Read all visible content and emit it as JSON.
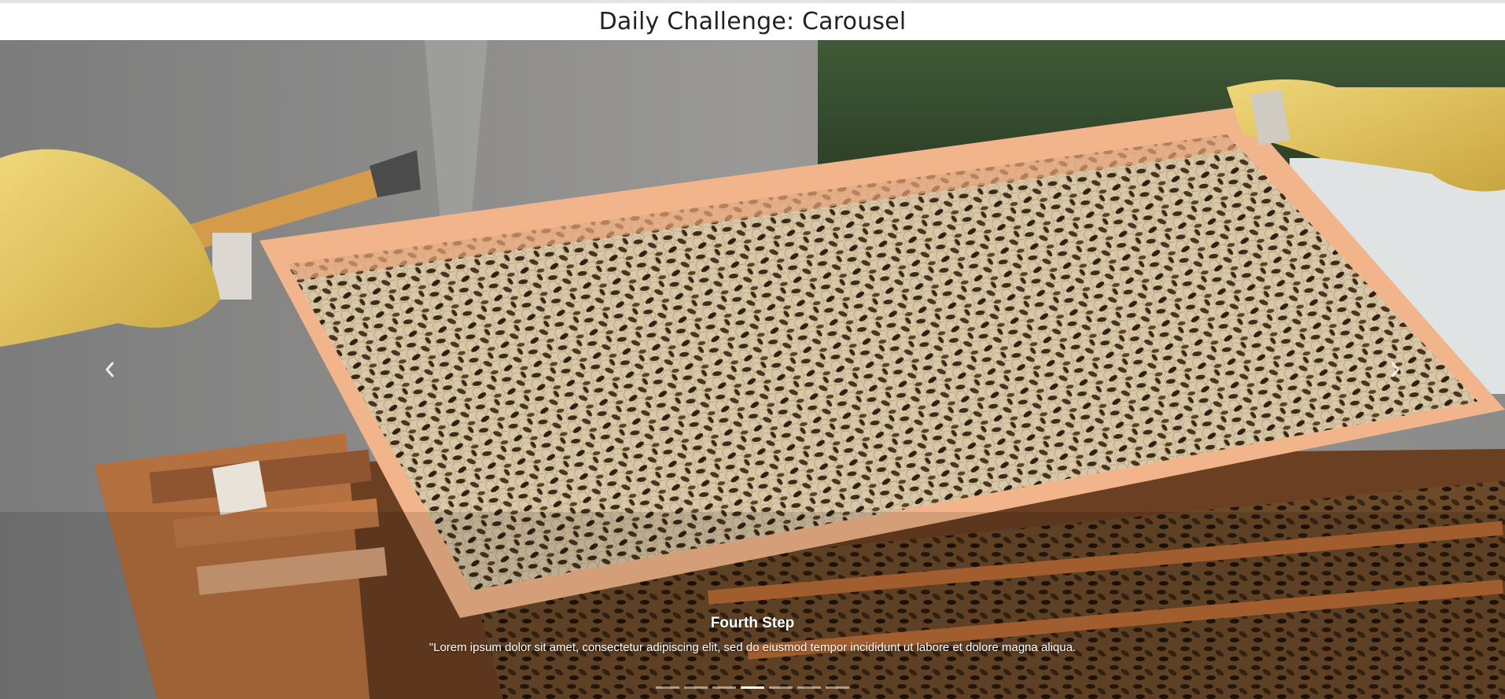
{
  "page": {
    "title": "Daily Challenge: Carousel"
  },
  "carousel": {
    "active_index": 3,
    "slide": {
      "image_icon": "beekeeper-honeycomb-frame-photo",
      "title": "Fourth Step",
      "text": "\"Lorem ipsum dolor sit amet, consectetur adipiscing elit, sed do eiusmod tempor incididunt ut labore et dolore magna aliqua."
    },
    "prev_icon": "chevron-left-icon",
    "next_icon": "chevron-right-icon",
    "indicator_count": 7
  },
  "colors": {
    "caption_text": "#ffffff",
    "header_text": "#222222"
  }
}
